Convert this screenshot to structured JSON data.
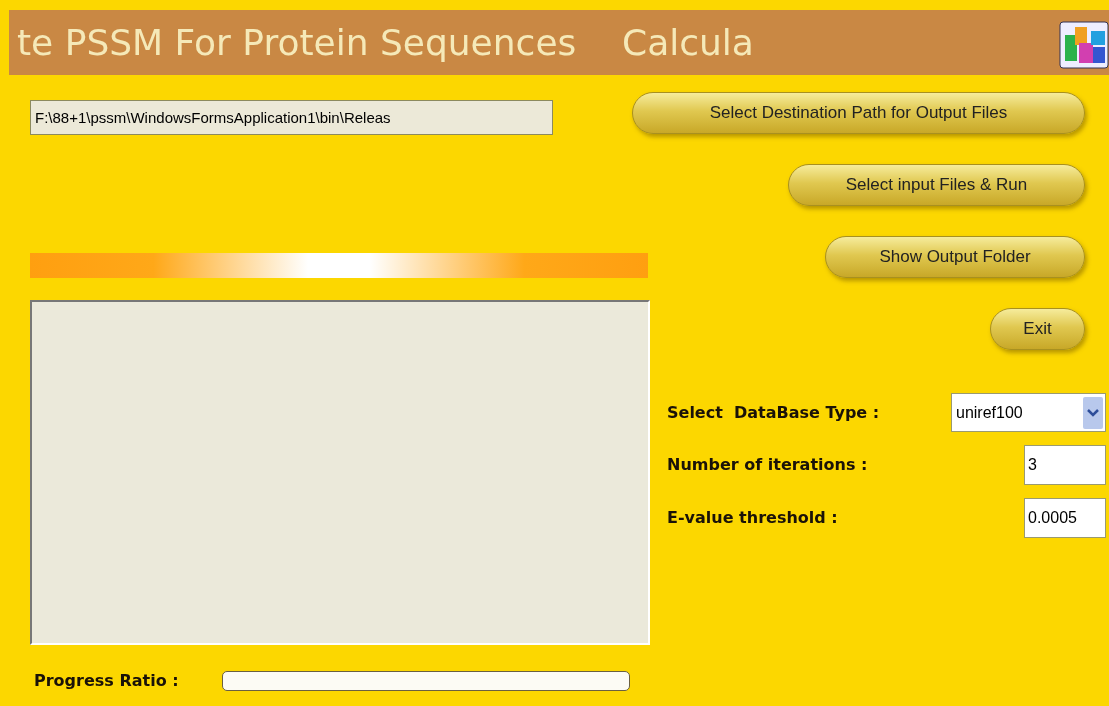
{
  "window": {
    "title": "te PSSM For Protein Sequences    Calcula"
  },
  "output_path": {
    "value": "F:\\88+1\\pssm\\WindowsFormsApplication1\\bin\\Releas"
  },
  "buttons": [
    {
      "label": "Select Destination Path for Output Files"
    },
    {
      "label": "Select input Files & Run"
    },
    {
      "label": "Show Output Folder"
    },
    {
      "label": "Exit"
    }
  ],
  "settings": [
    {
      "kind": "dropdown",
      "label": "Select  DataBase Type :",
      "value": "uniref100"
    },
    {
      "kind": "text",
      "label": "Number of iterations :",
      "value": "3"
    },
    {
      "kind": "text",
      "label": "E-value threshold :",
      "value": "0.0005"
    }
  ],
  "progress": {
    "label": "Progress Ratio :",
    "level": 0
  }
}
